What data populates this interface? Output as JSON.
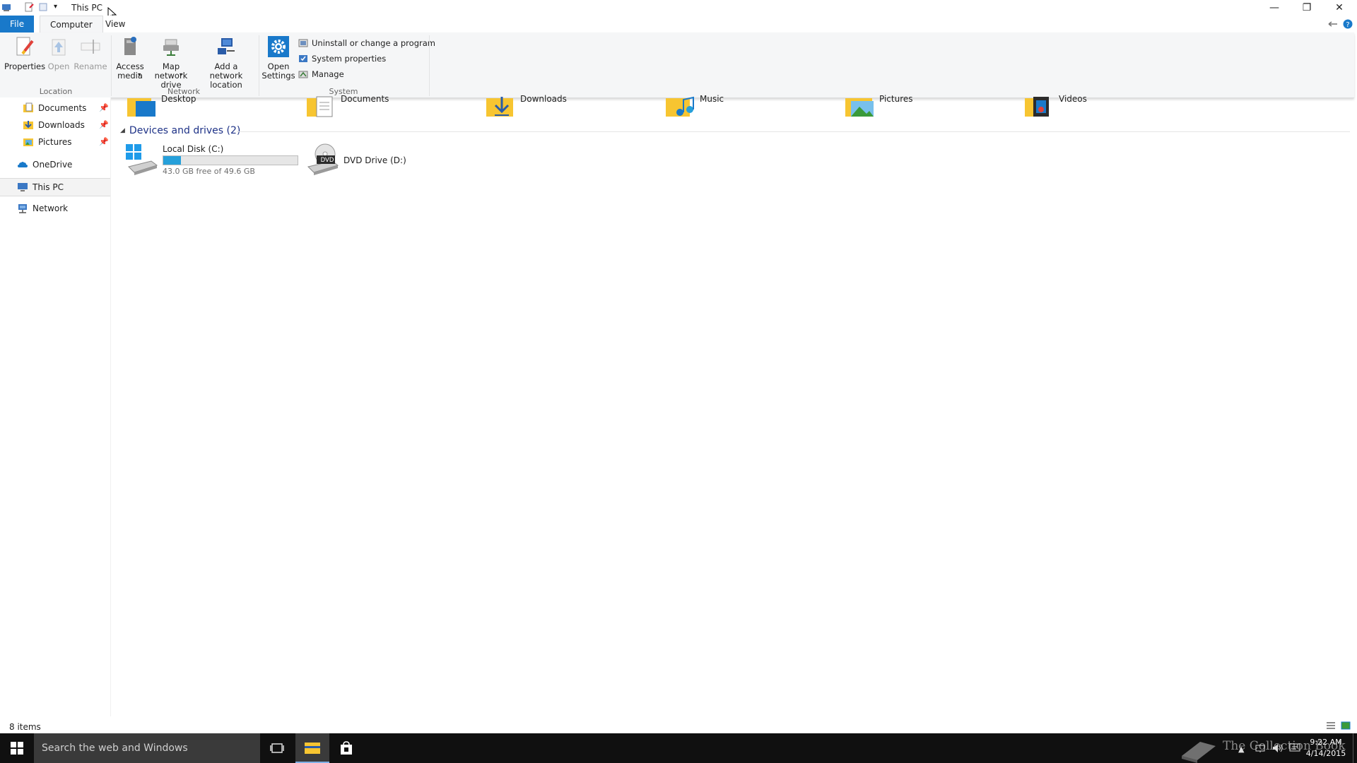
{
  "window": {
    "title": "This PC",
    "minimize_glyph": "—",
    "restore_glyph": "❐",
    "close_glyph": "✕"
  },
  "ribbon": {
    "tabs": [
      "File",
      "Computer",
      "View"
    ],
    "location": {
      "label": "Location",
      "properties": "Properties",
      "open": "Open",
      "rename": "Rename"
    },
    "network": {
      "label": "Network",
      "access_media": "Access media",
      "map_network_drive": "Map network drive",
      "add_network_location": "Add a network location"
    },
    "system": {
      "label": "System",
      "open_settings": "Open Settings",
      "uninstall": "Uninstall or change a program",
      "system_properties": "System properties",
      "manage": "Manage"
    }
  },
  "nav": {
    "items": [
      {
        "label": "Documents",
        "icon": "documents-folder-icon",
        "pinned": true
      },
      {
        "label": "Downloads",
        "icon": "downloads-folder-icon",
        "pinned": true
      },
      {
        "label": "Pictures",
        "icon": "pictures-folder-icon",
        "pinned": true
      },
      {
        "label": "OneDrive",
        "icon": "onedrive-icon",
        "pinned": false
      },
      {
        "label": "This PC",
        "icon": "computer-icon",
        "pinned": false
      },
      {
        "label": "Network",
        "icon": "network-icon",
        "pinned": false
      }
    ]
  },
  "folders": [
    {
      "label": "Desktop"
    },
    {
      "label": "Documents"
    },
    {
      "label": "Downloads"
    },
    {
      "label": "Music"
    },
    {
      "label": "Pictures"
    },
    {
      "label": "Videos"
    }
  ],
  "devices": {
    "header": "Devices and drives (2)",
    "drives": [
      {
        "name": "Local Disk (C:)",
        "free_text": "43.0 GB free of 49.6 GB",
        "used_fraction": 0.133
      },
      {
        "name": "DVD Drive (D:)",
        "badge": "DVD"
      }
    ]
  },
  "status": {
    "items_count": "8 items"
  },
  "taskbar": {
    "search_placeholder": "Search the web and Windows",
    "watermark": "The Collection Book",
    "time": "9:22 AM",
    "date": "4/14/2015"
  },
  "colors": {
    "accent": "#1979ca",
    "drive_bar": "#26a0da",
    "header_blue": "#1e3287",
    "folder_yellow": "#f7c531"
  }
}
